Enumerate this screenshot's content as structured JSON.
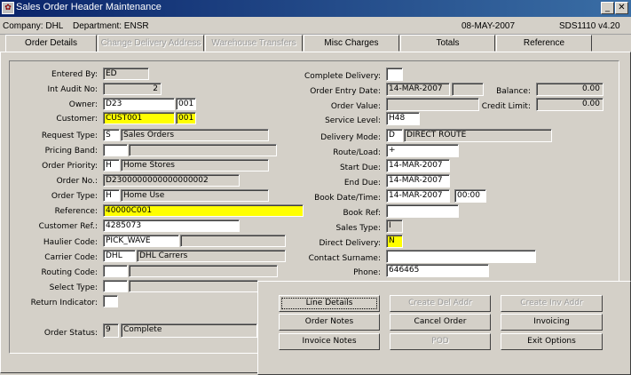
{
  "window": {
    "title": "Sales Order Header Maintenance"
  },
  "info": {
    "company": "Company: DHL",
    "department": "Department: ENSR",
    "date": "08-MAY-2007",
    "version": "SDS1110  v4.20"
  },
  "tabs": [
    "Order Details",
    "Change Delivery Address",
    "Warehouse Transfers",
    "Misc Charges",
    "Totals",
    "Reference"
  ],
  "left": {
    "entered_by": {
      "label": "Entered By:",
      "value": "ED"
    },
    "int_audit_no": {
      "label": "Int Audit No:",
      "value": "2"
    },
    "owner": {
      "label": "Owner:",
      "value": "D23",
      "value2": "001"
    },
    "customer": {
      "label": "Customer:",
      "value": "CUST001",
      "value2": "001"
    },
    "request_type": {
      "label": "Request Type:",
      "code": "S",
      "desc": "Sales Orders"
    },
    "pricing_band": {
      "label": "Pricing Band:",
      "code": "",
      "desc": ""
    },
    "order_priority": {
      "label": "Order Priority:",
      "code": "H",
      "desc": "Home Stores"
    },
    "order_no": {
      "label": "Order No.:",
      "value": "D2300000000000000002"
    },
    "order_type": {
      "label": "Order Type:",
      "code": "H",
      "desc": "Home Use"
    },
    "reference": {
      "label": "Reference:",
      "value": "40000C001"
    },
    "customer_ref": {
      "label": "Customer Ref.:",
      "value": "4285073"
    },
    "haulier_code": {
      "label": "Haulier Code:",
      "code": "PICK_WAVE",
      "desc": ""
    },
    "carrier_code": {
      "label": "Carrier Code:",
      "code": "DHL",
      "desc": "DHL Carrers"
    },
    "routing_code": {
      "label": "Routing Code:",
      "code": "",
      "desc": ""
    },
    "select_type": {
      "label": "Select Type:",
      "code": "",
      "desc": ""
    },
    "return_indicator": {
      "label": "Return Indicator:",
      "value": ""
    },
    "order_status": {
      "label": "Order Status:",
      "code": "9",
      "desc": "Complete"
    }
  },
  "right": {
    "complete_delivery": {
      "label": "Complete Delivery:",
      "value": ""
    },
    "order_entry_date": {
      "label": "Order Entry Date:",
      "value": "14-MAR-2007",
      "value2": ""
    },
    "order_value": {
      "label": "Order Value:",
      "value": ""
    },
    "service_level": {
      "label": "Service Level:",
      "value": "H48"
    },
    "delivery_mode": {
      "label": "Delivery Mode:",
      "code": "D",
      "desc": "DIRECT ROUTE"
    },
    "route_load": {
      "label": "Route/Load:",
      "value": "+"
    },
    "start_due": {
      "label": "Start Due:",
      "value": "14-MAR-2007"
    },
    "end_due": {
      "label": "End Due:",
      "value": "14-MAR-2007"
    },
    "book_date_time": {
      "label": "Book Date/Time:",
      "value": "14-MAR-2007",
      "time": "00:00"
    },
    "book_ref": {
      "label": "Book Ref:",
      "value": ""
    },
    "sales_type": {
      "label": "Sales Type:",
      "value": "I"
    },
    "direct_delivery": {
      "label": "Direct Delivery:",
      "value": "N"
    },
    "contact_surname": {
      "label": "Contact Surname:",
      "value": ""
    },
    "phone": {
      "label": "Phone:",
      "value": "646465"
    },
    "balance": {
      "label": "Balance:",
      "value": "0.00"
    },
    "credit_limit": {
      "label": "Credit Limit:",
      "value": "0.00"
    }
  },
  "buttons": [
    "Line Details",
    "Create Del Addr",
    "Create Inv Addr",
    "Order Notes",
    "Cancel Order",
    "Invoicing",
    "Invoice Notes",
    "POD",
    "Exit Options"
  ],
  "colors": {
    "title_bar": "#0a246a",
    "highlight": "#ffff00",
    "face": "#d4d0c8"
  }
}
